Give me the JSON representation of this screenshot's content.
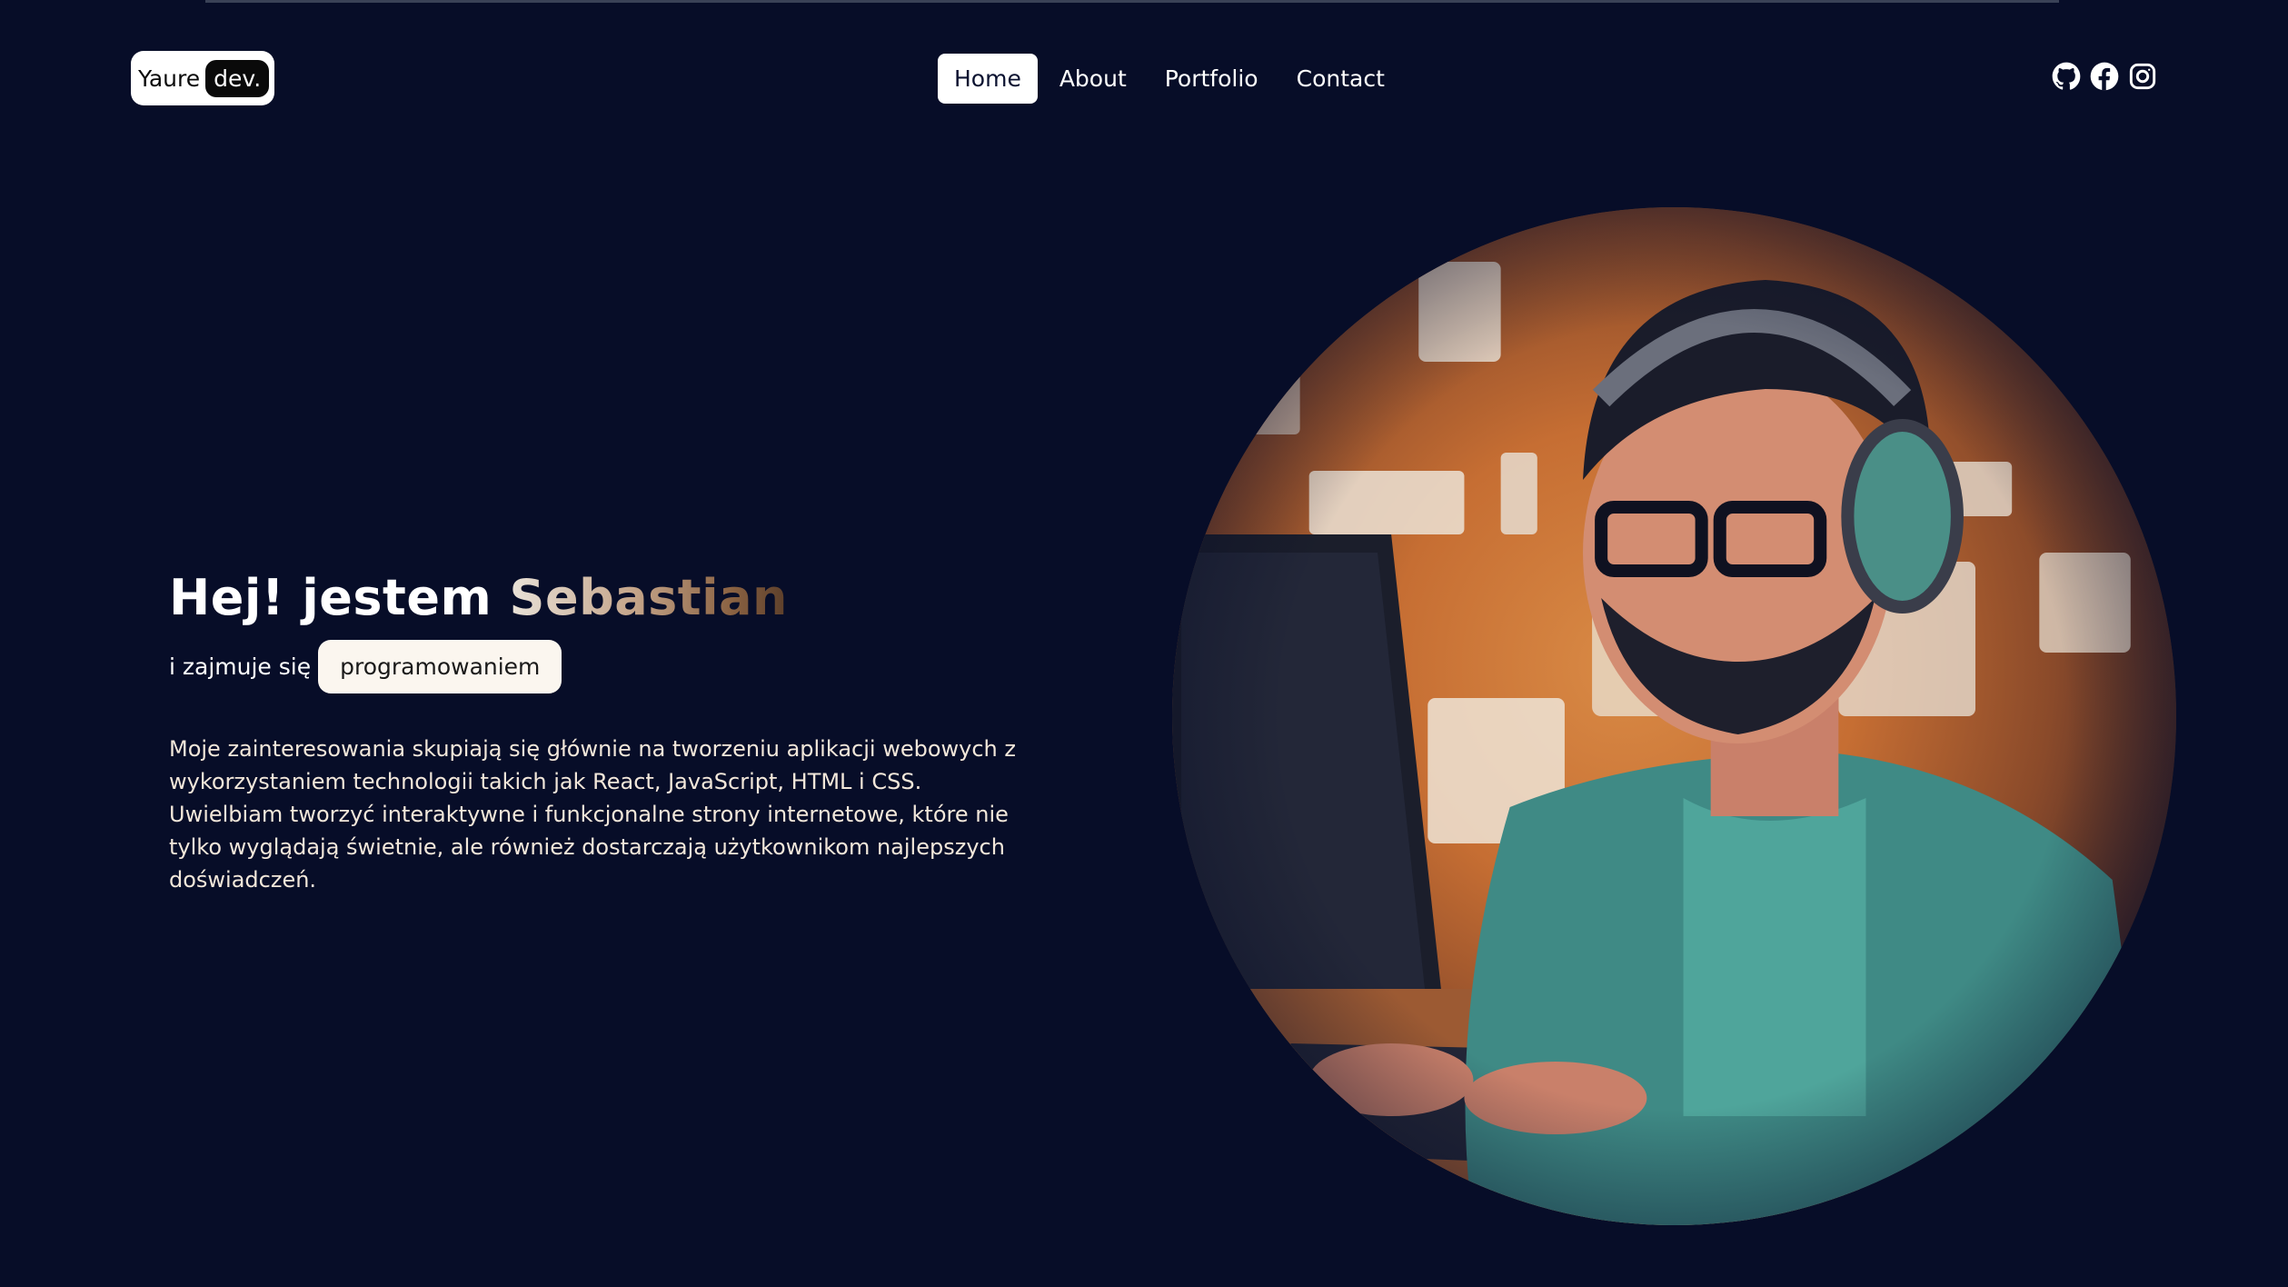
{
  "header": {
    "logo": {
      "text": "Yaure",
      "pill": "dev."
    },
    "nav": [
      {
        "label": "Home",
        "active": true
      },
      {
        "label": "About",
        "active": false
      },
      {
        "label": "Portfolio",
        "active": false
      },
      {
        "label": "Contact",
        "active": false
      }
    ],
    "socials": [
      "github-icon",
      "facebook-icon",
      "instagram-icon"
    ]
  },
  "hero": {
    "title_prefix": "Hej! jestem ",
    "title_name": "Sebastian",
    "subtitle_prefix": "i zajmuje się",
    "subtitle_skill": "programowaniem",
    "description": "Moje zainteresowania skupiają się głównie na tworzeniu aplikacji webowych z wykorzystaniem technologii takich jak React, JavaScript, HTML i CSS. Uwielbiam tworzyć interaktywne i funkcjonalne strony internetowe, które nie tylko wyglądają świetnie, ale również dostarczają użytkownikom najlepszych doświadczeń."
  },
  "colors": {
    "background": "#070d28",
    "accent_light": "#ffffff",
    "text_warm": "#f2e7da",
    "illustration_orange": "#d98a45",
    "illustration_teal": "#3f8a85"
  }
}
